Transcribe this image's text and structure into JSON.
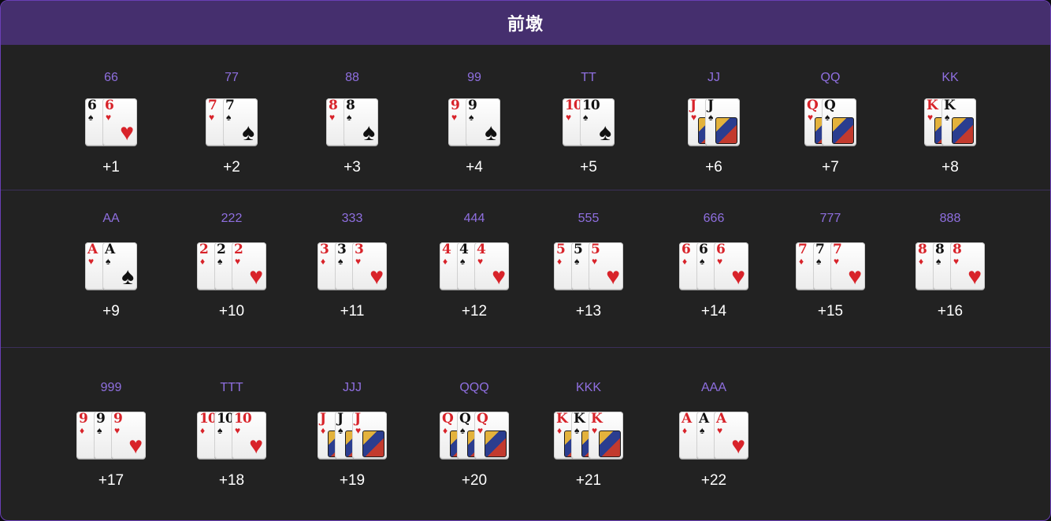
{
  "title": "前墩",
  "colors": {
    "combo_label": "#8f6fe0",
    "header_bg": "#452f6e",
    "panel_bg": "#222222"
  },
  "rows": [
    {
      "items": [
        {
          "combo": "66",
          "score": "+1",
          "cards": [
            {
              "rank": "6",
              "suit": "♠",
              "color": "black"
            },
            {
              "rank": "6",
              "suit": "♥",
              "color": "red"
            }
          ]
        },
        {
          "combo": "77",
          "score": "+2",
          "cards": [
            {
              "rank": "7",
              "suit": "♥",
              "color": "red"
            },
            {
              "rank": "7",
              "suit": "♠",
              "color": "black"
            }
          ]
        },
        {
          "combo": "88",
          "score": "+3",
          "cards": [
            {
              "rank": "8",
              "suit": "♥",
              "color": "red"
            },
            {
              "rank": "8",
              "suit": "♠",
              "color": "black"
            }
          ]
        },
        {
          "combo": "99",
          "score": "+4",
          "cards": [
            {
              "rank": "9",
              "suit": "♥",
              "color": "red"
            },
            {
              "rank": "9",
              "suit": "♠",
              "color": "black"
            }
          ]
        },
        {
          "combo": "TT",
          "score": "+5",
          "cards": [
            {
              "rank": "10",
              "suit": "♥",
              "color": "red"
            },
            {
              "rank": "10",
              "suit": "♠",
              "color": "black"
            }
          ]
        },
        {
          "combo": "JJ",
          "score": "+6",
          "cards": [
            {
              "rank": "J",
              "suit": "♥",
              "color": "red",
              "face": true
            },
            {
              "rank": "J",
              "suit": "♠",
              "color": "black",
              "face": true
            }
          ]
        },
        {
          "combo": "QQ",
          "score": "+7",
          "cards": [
            {
              "rank": "Q",
              "suit": "♥",
              "color": "red",
              "face": true
            },
            {
              "rank": "Q",
              "suit": "♠",
              "color": "black",
              "face": true
            }
          ]
        },
        {
          "combo": "KK",
          "score": "+8",
          "cards": [
            {
              "rank": "K",
              "suit": "♥",
              "color": "red",
              "face": true
            },
            {
              "rank": "K",
              "suit": "♠",
              "color": "black",
              "face": true
            }
          ]
        }
      ]
    },
    {
      "items": [
        {
          "combo": "AA",
          "score": "+9",
          "cards": [
            {
              "rank": "A",
              "suit": "♥",
              "color": "red"
            },
            {
              "rank": "A",
              "suit": "♠",
              "color": "black"
            }
          ]
        },
        {
          "combo": "222",
          "score": "+10",
          "cards": [
            {
              "rank": "2",
              "suit": "♦",
              "color": "red"
            },
            {
              "rank": "2",
              "suit": "♠",
              "color": "black"
            },
            {
              "rank": "2",
              "suit": "♥",
              "color": "red"
            }
          ]
        },
        {
          "combo": "333",
          "score": "+11",
          "cards": [
            {
              "rank": "3",
              "suit": "♦",
              "color": "red"
            },
            {
              "rank": "3",
              "suit": "♠",
              "color": "black"
            },
            {
              "rank": "3",
              "suit": "♥",
              "color": "red"
            }
          ]
        },
        {
          "combo": "444",
          "score": "+12",
          "cards": [
            {
              "rank": "4",
              "suit": "♦",
              "color": "red"
            },
            {
              "rank": "4",
              "suit": "♠",
              "color": "black"
            },
            {
              "rank": "4",
              "suit": "♥",
              "color": "red"
            }
          ]
        },
        {
          "combo": "555",
          "score": "+13",
          "cards": [
            {
              "rank": "5",
              "suit": "♦",
              "color": "red"
            },
            {
              "rank": "5",
              "suit": "♠",
              "color": "black"
            },
            {
              "rank": "5",
              "suit": "♥",
              "color": "red"
            }
          ]
        },
        {
          "combo": "666",
          "score": "+14",
          "cards": [
            {
              "rank": "6",
              "suit": "♦",
              "color": "red"
            },
            {
              "rank": "6",
              "suit": "♠",
              "color": "black"
            },
            {
              "rank": "6",
              "suit": "♥",
              "color": "red"
            }
          ]
        },
        {
          "combo": "777",
          "score": "+15",
          "cards": [
            {
              "rank": "7",
              "suit": "♦",
              "color": "red"
            },
            {
              "rank": "7",
              "suit": "♠",
              "color": "black"
            },
            {
              "rank": "7",
              "suit": "♥",
              "color": "red"
            }
          ]
        },
        {
          "combo": "888",
          "score": "+16",
          "cards": [
            {
              "rank": "8",
              "suit": "♦",
              "color": "red"
            },
            {
              "rank": "8",
              "suit": "♠",
              "color": "black"
            },
            {
              "rank": "8",
              "suit": "♥",
              "color": "red"
            }
          ]
        }
      ]
    },
    {
      "items": [
        {
          "combo": "999",
          "score": "+17",
          "cards": [
            {
              "rank": "9",
              "suit": "♦",
              "color": "red"
            },
            {
              "rank": "9",
              "suit": "♠",
              "color": "black"
            },
            {
              "rank": "9",
              "suit": "♥",
              "color": "red"
            }
          ]
        },
        {
          "combo": "TTT",
          "score": "+18",
          "cards": [
            {
              "rank": "10",
              "suit": "♦",
              "color": "red"
            },
            {
              "rank": "10",
              "suit": "♠",
              "color": "black"
            },
            {
              "rank": "10",
              "suit": "♥",
              "color": "red"
            }
          ]
        },
        {
          "combo": "JJJ",
          "score": "+19",
          "cards": [
            {
              "rank": "J",
              "suit": "♦",
              "color": "red",
              "face": true
            },
            {
              "rank": "J",
              "suit": "♠",
              "color": "black",
              "face": true
            },
            {
              "rank": "J",
              "suit": "♥",
              "color": "red",
              "face": true
            }
          ]
        },
        {
          "combo": "QQQ",
          "score": "+20",
          "cards": [
            {
              "rank": "Q",
              "suit": "♦",
              "color": "red",
              "face": true
            },
            {
              "rank": "Q",
              "suit": "♠",
              "color": "black",
              "face": true
            },
            {
              "rank": "Q",
              "suit": "♥",
              "color": "red",
              "face": true
            }
          ]
        },
        {
          "combo": "KKK",
          "score": "+21",
          "cards": [
            {
              "rank": "K",
              "suit": "♦",
              "color": "red",
              "face": true
            },
            {
              "rank": "K",
              "suit": "♠",
              "color": "black",
              "face": true
            },
            {
              "rank": "K",
              "suit": "♥",
              "color": "red",
              "face": true
            }
          ]
        },
        {
          "combo": "AAA",
          "score": "+22",
          "cards": [
            {
              "rank": "A",
              "suit": "♦",
              "color": "red"
            },
            {
              "rank": "A",
              "suit": "♠",
              "color": "black"
            },
            {
              "rank": "A",
              "suit": "♥",
              "color": "red"
            }
          ]
        }
      ]
    }
  ]
}
